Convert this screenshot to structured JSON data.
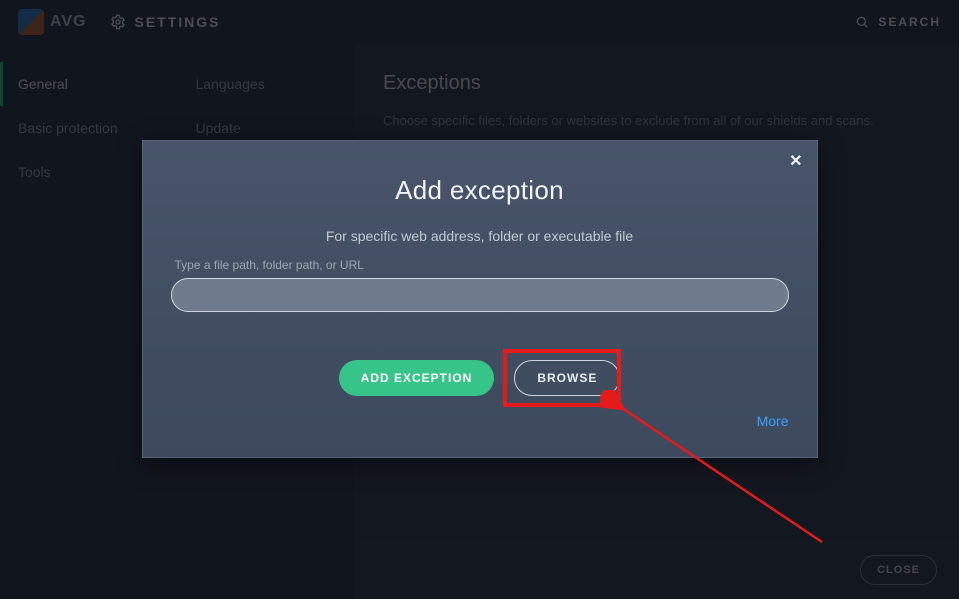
{
  "header": {
    "brand": "AVG",
    "settings": "SETTINGS",
    "search": "SEARCH"
  },
  "sidebar": {
    "general": "General",
    "languages": "Languages",
    "basic_protection": "Basic protection",
    "update": "Update",
    "tools": "Tools"
  },
  "page": {
    "title": "Exceptions",
    "desc": "Choose specific files, folders or websites to exclude from all of our shields and scans."
  },
  "footer": {
    "close": "CLOSE"
  },
  "modal": {
    "title": "Add exception",
    "subtitle": "For specific web address, folder or executable file",
    "input_label": "Type a file path, folder path, or URL",
    "input_value": "",
    "add_btn": "ADD EXCEPTION",
    "browse_btn": "BROWSE",
    "more": "More",
    "close_x": "✕"
  }
}
